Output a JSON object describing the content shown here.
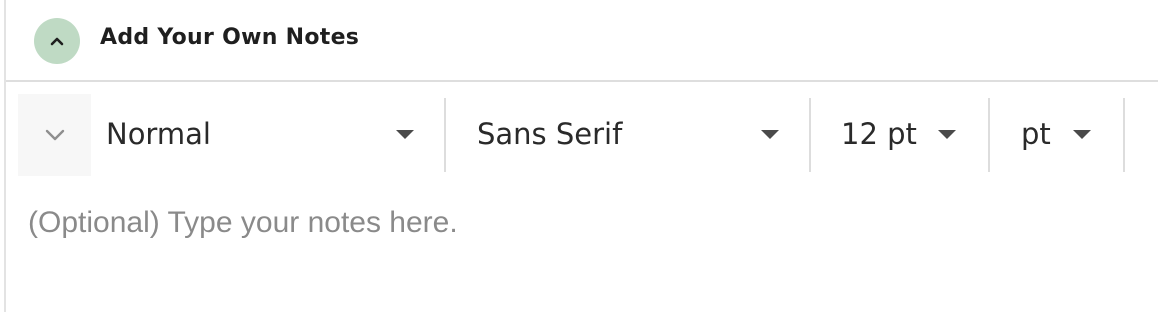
{
  "section": {
    "title": "Add Your Own Notes",
    "toggle_icon": "chevron-up-icon",
    "accent": "#bfdac4"
  },
  "toolbar": {
    "more_icon": "chevron-down-icon",
    "style_select": {
      "value": "Normal"
    },
    "font_select": {
      "value": "Sans Serif"
    },
    "size_select": {
      "value": "12 pt"
    },
    "unit_select": {
      "value": "pt"
    }
  },
  "notes": {
    "value": "",
    "placeholder": "(Optional) Type your notes here."
  }
}
